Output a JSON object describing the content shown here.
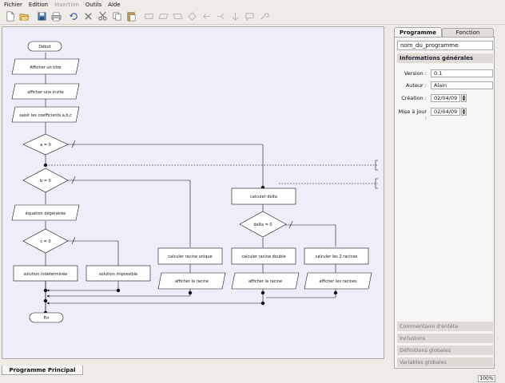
{
  "menu": {
    "items": [
      {
        "label": "Fichier",
        "enabled": true
      },
      {
        "label": "Edition",
        "enabled": true
      },
      {
        "label": "Insertion",
        "enabled": false
      },
      {
        "label": "Outils",
        "enabled": true
      },
      {
        "label": "Aide",
        "enabled": true
      }
    ]
  },
  "toolbar": {
    "icons": [
      "new-document-icon",
      "open-folder-icon",
      "save-icon",
      "print-icon",
      "undo-icon",
      "delete-icon",
      "cut-icon",
      "copy-icon",
      "paste-icon",
      "insert-action-icon",
      "insert-input-icon",
      "insert-output-icon",
      "insert-condition-icon",
      "insert-loop-icon",
      "insert-branch-icon",
      "insert-end-icon",
      "insert-comment-icon",
      "tools-icon"
    ]
  },
  "flowchart": {
    "debut": "Début",
    "fin": "Fin",
    "afficher_titre": "Afficher un titre",
    "afficher_invite": "afficher une invite",
    "saisir": "saisir les coefficients a,b,c",
    "cond_a": "a = 0",
    "cond_b": "b = 0",
    "equation": "équation dégénérée",
    "cond_c": "c = 0",
    "sol_indet": "solution indéterminée",
    "sol_imposs": "solution impossible",
    "calc_unique": "calculer racine unique",
    "aff_racine1": "afficher la racine",
    "calc_delta": "calculer delta",
    "cond_delta": "delta = 0",
    "calc_double": "calculer racine double",
    "aff_racine2": "afficher la racine",
    "calc_deux": "calculer les 2 racines",
    "aff_racines": "afficher les racines"
  },
  "bottom_tab": "Programme Principal",
  "zoom": "100%",
  "side_panel": {
    "tabs": [
      "Programme",
      "Fonction"
    ],
    "program_name": "nom_du_programme",
    "section_title": "Informations générales",
    "version_label": "Version :",
    "version_value": "0.1",
    "author_label": "Auteur :",
    "author_value": "Alain",
    "created_label": "Création :",
    "created_value": "02/04/09",
    "updated_label": "Mise à jour :",
    "updated_value": "02/04/09",
    "sections": [
      "Commentaire d'entête",
      "Inclusions",
      "Définitions globales",
      "Variables globales"
    ]
  }
}
